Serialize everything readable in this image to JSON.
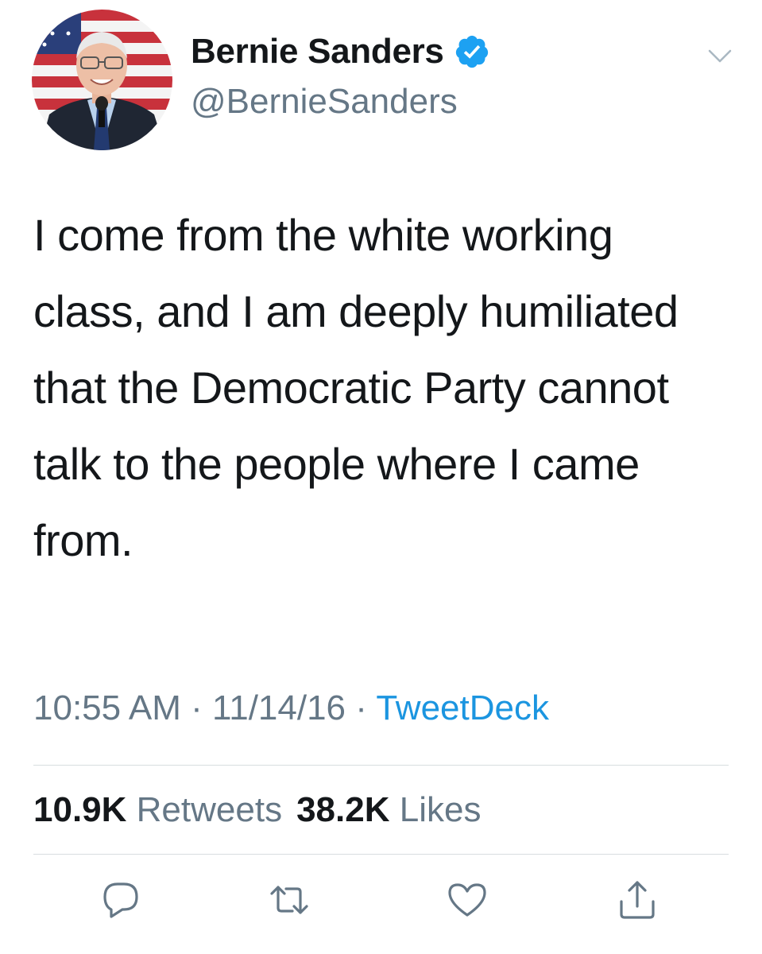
{
  "user": {
    "display_name": "Bernie Sanders",
    "handle": "@BernieSanders",
    "verified": true,
    "avatar_icon": "profile-photo"
  },
  "tweet": {
    "text": "I come from the white working class, and I am deeply humiliated that the Democratic Party cannot talk to the people where I came from.",
    "time": "10:55 AM",
    "separator": " · ",
    "date": "11/14/16",
    "source": "TweetDeck"
  },
  "stats": {
    "retweets_count": "10.9K",
    "retweets_label": "Retweets",
    "likes_count": "38.2K",
    "likes_label": "Likes"
  },
  "actions": {
    "reply_icon": "reply-icon",
    "retweet_icon": "retweet-icon",
    "like_icon": "heart-icon",
    "share_icon": "share-icon"
  },
  "colors": {
    "text": "#14171a",
    "secondary": "#657786",
    "link": "#1b95e0",
    "verified": "#1da1f2",
    "divider": "#d8dde0"
  }
}
